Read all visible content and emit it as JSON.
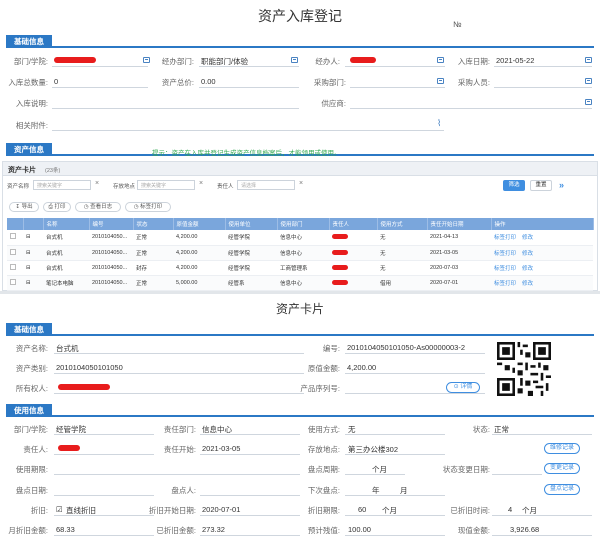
{
  "form": {
    "title": "资产入库登记",
    "no_label": "№",
    "section_basic": "基础信息",
    "section_asset": "资产信息",
    "tip": "提示：资产在入库并登记生成资产信息档案后，才能领用或使用。",
    "fields": {
      "dept_label": "部门/学院:",
      "handle_dept_label": "经办部门:",
      "handle_dept_value": "职能部门/体验",
      "handler_label": "经办人:",
      "date_label": "入库日期:",
      "date_value": "2021-05-22",
      "qty_label": "入库总数量:",
      "qty_value": "0",
      "total_label": "资产总价:",
      "total_value": "0.00",
      "purchase_dept_label": "采购部门:",
      "buyer_label": "采购人员:",
      "desc_label": "入库说明:",
      "supplier_label": "供应商:",
      "attach_label": "相关附件:"
    }
  },
  "asset_table": {
    "title": "资产卡片",
    "count": "(23条)",
    "filters": {
      "name_label": "资产名称",
      "name_placeholder": "搜索关键字",
      "tag_label": "存放地点",
      "tag_placeholder": "搜索关键字",
      "owner_label": "责任人",
      "owner_placeholder": "请选择"
    },
    "search_button": "筛选",
    "reset_button": "重置",
    "toolbar": [
      "导出",
      "打印",
      "查看日志",
      "标签打印"
    ],
    "columns": [
      "",
      "",
      "名称",
      "编号",
      "状态",
      "原值金额",
      "使用单位",
      "使用部门",
      "责任人",
      "使用方式",
      "责任开始日期",
      "操作"
    ],
    "rows": [
      {
        "name": "台式机",
        "code": "2010104050...",
        "status": "正常",
        "amount": "4,200.00",
        "unit": "经管学院",
        "dept": "信息中心",
        "mode": "无",
        "date": "2021-04-13"
      },
      {
        "name": "台式机",
        "code": "2010104050...",
        "status": "正常",
        "amount": "4,200.00",
        "unit": "经管学院",
        "dept": "信息中心",
        "mode": "无",
        "date": "2021-03-05"
      },
      {
        "name": "台式机",
        "code": "2010104050...",
        "status": "封存",
        "amount": "4,200.00",
        "unit": "经管学院",
        "dept": "工商管理系",
        "mode": "无",
        "date": "2020-07-03"
      },
      {
        "name": "笔记本电脑",
        "code": "2010104050...",
        "status": "正常",
        "amount": "5,000.00",
        "unit": "经管系",
        "dept": "信息中心",
        "mode": "借用",
        "date": "2020-07-01"
      }
    ],
    "row_actions": [
      "标签打印",
      "修改"
    ]
  },
  "card": {
    "title": "资产卡片",
    "section_basic": "基础信息",
    "section_use": "使用信息",
    "asset_name_label": "资产名称:",
    "asset_name_value": "台式机",
    "code_label": "编号:",
    "code_value": "2010104050101050-As00000003-2",
    "category_label": "资产类别:",
    "category_value": "2010104050101050",
    "amount_label": "原值金额:",
    "amount_value": "4,200.00",
    "owner_label": "所有权人:",
    "serial_label": "产品序列号:",
    "detail_button": "详情",
    "use_dept_label": "部门/学院:",
    "use_dept_value": "经管学院",
    "resp_dept_label": "责任部门:",
    "resp_dept_value": "信息中心",
    "use_mode_label": "使用方式:",
    "use_mode_value": "无",
    "state_label": "状态:",
    "state_value": "正常",
    "resp_person_label": "责任人:",
    "resp_start_label": "责任开始:",
    "resp_start_value": "2021-03-05",
    "location_label": "存放地点:",
    "location_value": "第三办公楼302",
    "use_period_label": "使用期限:",
    "check_cycle_label": "盘点周期:",
    "check_cycle_unit": "个月",
    "state_change_label": "状态变更日期:",
    "check_date_label": "盘点日期:",
    "checker_label": "盘点人:",
    "next_check_label": "下次盘点:",
    "next_check_year": "年",
    "next_check_month": "月",
    "depr_label": "折旧:",
    "depr_value": "直线折旧",
    "depr_start_label": "折旧开始日期:",
    "depr_start_value": "2020-07-01",
    "depr_period_label": "折旧期限:",
    "depr_period_value": "60",
    "depr_period_unit": "个月",
    "depr_time_label": "已折旧时间:",
    "depr_time_value": "4",
    "depr_time_unit": "个月",
    "monthly_depr_label": "月折旧金额:",
    "monthly_depr_value": "68.33",
    "accum_depr_label": "已折旧金额:",
    "accum_depr_value": "273.32",
    "residual_label": "预计残值:",
    "residual_value": "100.00",
    "net_label": "现值金额:",
    "net_value": "3,926.68",
    "buttons": [
      "维修记录",
      "变更记录",
      "盘点记录"
    ]
  }
}
